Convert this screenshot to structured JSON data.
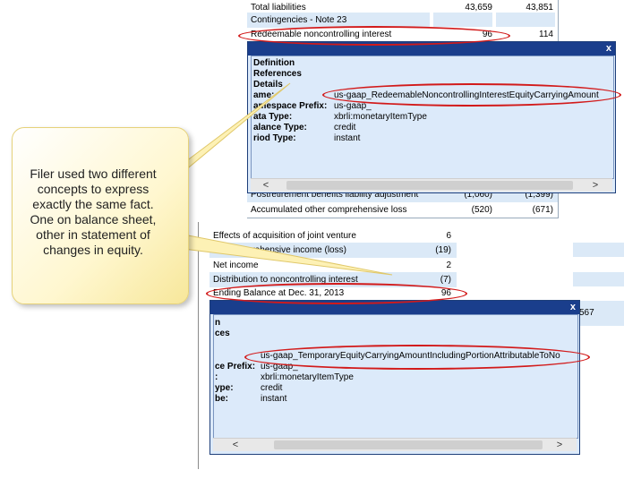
{
  "balance_sheet": {
    "rows": [
      {
        "label": "Total liabilities",
        "v1": "43,659",
        "v2": "43,851"
      },
      {
        "label": "Contingencies - Note 23",
        "v1": "",
        "v2": ""
      },
      {
        "label": "Redeemable noncontrolling interest",
        "v1": "96",
        "v2": "114"
      }
    ],
    "lower_rows": [
      {
        "label": "Postretirement benefits liability adjustment",
        "v1": "(1,060)",
        "v2": "(1,399)"
      },
      {
        "label": "Accumulated other comprehensive loss",
        "v1": "(520)",
        "v2": "(671)"
      }
    ]
  },
  "popup1": {
    "close": "x",
    "lines": [
      "Definition",
      "References",
      "Details",
      "ame:",
      "amespace Prefix:",
      "ata Type:",
      "alance Type:",
      "riod Type:"
    ],
    "values": [
      "us-gaap_RedeemableNoncontrollingInterestEquityCarryingAmount",
      "us-gaap_",
      "xbrli:monetaryItemType",
      "credit",
      "instant"
    ],
    "scroll_left": "<",
    "scroll_right": ">"
  },
  "equity": {
    "rows": [
      {
        "label": "Effects of acquisition of joint venture",
        "value": "6"
      },
      {
        "label": "O... comprehensive income (loss)",
        "value": "(19)"
      },
      {
        "label": "Net income",
        "value": "2"
      },
      {
        "label": "Distribution to noncontrolling interest",
        "value": "(7)"
      },
      {
        "label": "Ending Balance at Dec. 31, 2013",
        "value": "96"
      }
    ],
    "extra_value": "567"
  },
  "popup2": {
    "close": "x",
    "lines": [
      "n",
      "ces",
      "ce Prefix:",
      ":",
      "ype:",
      "be:"
    ],
    "values": [
      "us-gaap_TemporaryEquityCarryingAmountIncludingPortionAttributableToNo",
      "us-gaap_",
      "xbrli:monetaryItemType",
      "credit",
      "instant"
    ],
    "scroll_left": "<",
    "scroll_right": ">"
  },
  "callout": {
    "text": "Filer used two different concepts to express exactly the same fact. One on balance sheet, other in statement of changes in equity."
  },
  "colors": {
    "highlight": "#d21a1a",
    "popup_title": "#1a3e8c",
    "row_bg": "#dbe9f7"
  }
}
